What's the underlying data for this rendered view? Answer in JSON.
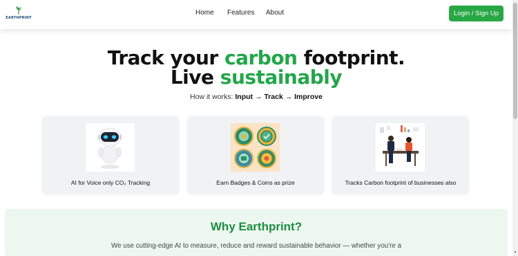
{
  "brand": {
    "logo_text": "EARTHPRINT",
    "accent": "#28a745",
    "headline_green": "#22a64a"
  },
  "nav": {
    "home": "Home",
    "features": "Features",
    "about": "About",
    "login": "Login / Sign Up"
  },
  "hero": {
    "title_part1": "Track your ",
    "title_green1": "carbon",
    "title_part2": " footprint.",
    "title_part3": "Live ",
    "title_green2": "sustainably",
    "how_prefix": "How it works: ",
    "how_steps": "Input → Track → Improve"
  },
  "features": [
    {
      "caption": "AI for Voice only CO₂ Tracking",
      "icon": "robot-icon"
    },
    {
      "caption": "Earn Badges & Coins as prize",
      "icon": "badges-icon"
    },
    {
      "caption": "Tracks Carbon footprint of businesses also",
      "icon": "business-meeting-icon"
    }
  ],
  "why": {
    "title": "Why Earthprint?",
    "text": "We use cutting-edge AI to measure, reduce and reward sustainable behavior — whether you're a"
  }
}
